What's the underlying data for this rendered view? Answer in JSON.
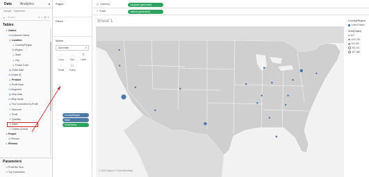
{
  "left_pane": {
    "tabs": [
      "Data",
      "Analytics"
    ],
    "source": "Sample - Superstore",
    "search_placeholder": "Search",
    "tools": "≡ ▿ ▥ ▾",
    "tables_heading": "Tables",
    "fields": [
      {
        "label": "Orders",
        "kind": "head",
        "level": 1,
        "icon": "▾"
      },
      {
        "label": "Customer Name",
        "kind": "dim",
        "level": 2,
        "icon": "Abc"
      },
      {
        "label": "Location",
        "kind": "head",
        "level": 2,
        "icon": "▾"
      },
      {
        "label": "Country/Region",
        "kind": "dim",
        "level": 3,
        "icon": "⊕"
      },
      {
        "label": "Region",
        "kind": "dim",
        "level": 3,
        "icon": "Abc"
      },
      {
        "label": "State",
        "kind": "dim",
        "level": 3,
        "icon": "⊕"
      },
      {
        "label": "City",
        "kind": "dim",
        "level": 3,
        "icon": "⊕"
      },
      {
        "label": "Postal Code",
        "kind": "dim",
        "level": 3,
        "icon": "⊕"
      },
      {
        "label": "Order Date",
        "kind": "dim",
        "level": 2,
        "icon": "▦"
      },
      {
        "label": "Order ID",
        "kind": "dim",
        "level": 2,
        "icon": "Abc"
      },
      {
        "label": "Product",
        "kind": "head",
        "level": 2,
        "icon": "▸"
      },
      {
        "label": "Profit Ratio",
        "kind": "meas",
        "level": 2,
        "icon": "=#"
      },
      {
        "label": "Segment",
        "kind": "dim",
        "level": 2,
        "icon": "Abc"
      },
      {
        "label": "Ship Date",
        "kind": "dim",
        "level": 2,
        "icon": "▦"
      },
      {
        "label": "Ship Mode",
        "kind": "dim",
        "level": 2,
        "icon": "Abc"
      },
      {
        "label": "Top Customers by Profit",
        "kind": "dim",
        "level": 2,
        "icon": "◉"
      },
      {
        "label": "Discount",
        "kind": "meas",
        "level": 2,
        "icon": "#"
      },
      {
        "label": "Profit",
        "kind": "meas",
        "level": 2,
        "icon": "#"
      },
      {
        "label": "Quantity",
        "kind": "meas",
        "level": 2,
        "icon": "#"
      },
      {
        "label": "Sales",
        "kind": "meas",
        "level": 2,
        "icon": "#",
        "highlight": true
      },
      {
        "label": "Orders (Count)",
        "kind": "meas",
        "level": 2,
        "icon": "#"
      },
      {
        "label": "People",
        "kind": "head",
        "level": 1,
        "icon": "▾"
      },
      {
        "label": "Person",
        "kind": "dim",
        "level": 2,
        "icon": "Abc"
      },
      {
        "label": "Returns",
        "kind": "head",
        "level": 1,
        "icon": "▸"
      }
    ],
    "parameters_heading": "Parameters",
    "parameters": [
      "Profit Bin Size",
      "Top Customers"
    ]
  },
  "cards": {
    "pages": "Pages",
    "filters": "Filters",
    "marks": "Marks",
    "mark_type": "Automatic",
    "mark_buttons": [
      {
        "label": "Color",
        "icon": "∷"
      },
      {
        "label": "Size",
        "icon": "◌"
      },
      {
        "label": "Label",
        "icon": "T"
      },
      {
        "label": "Detail",
        "icon": "∴"
      },
      {
        "label": "Tooltip",
        "icon": "▭"
      }
    ],
    "mark_pills": [
      {
        "label": "Country/Region",
        "kind": "dim",
        "icon": "∴"
      },
      {
        "label": "State",
        "kind": "dim",
        "icon": "∴"
      },
      {
        "label": "SUM(Sales)",
        "kind": "meas",
        "icon": "◌"
      }
    ]
  },
  "shelves": {
    "columns_label": "Columns",
    "columns_pill": "Longitude (generated)",
    "rows_label": "Rows",
    "rows_pill": "Latitude (generated)"
  },
  "view": {
    "title": "Sheet 1",
    "attribution": "© 2024 Mapbox © OpenStreetMap",
    "points": [
      {
        "name": "Washington",
        "lon": -120.6,
        "lat": 47.4,
        "size": 1
      },
      {
        "name": "Oregon",
        "lon": -120.5,
        "lat": 44.0,
        "size": 1
      },
      {
        "name": "California",
        "lon": -119.5,
        "lat": 37.2,
        "size": 3
      },
      {
        "name": "Nevada",
        "lon": -116.6,
        "lat": 39.3,
        "size": 1
      },
      {
        "name": "Arizona",
        "lon": -111.7,
        "lat": 34.3,
        "size": 1
      },
      {
        "name": "Colorado",
        "lon": -105.5,
        "lat": 39.0,
        "size": 1
      },
      {
        "name": "Texas",
        "lon": -99.3,
        "lat": 31.4,
        "size": 2
      },
      {
        "name": "Illinois",
        "lon": -89.2,
        "lat": 40.0,
        "size": 1
      },
      {
        "name": "Michigan",
        "lon": -84.7,
        "lat": 43.5,
        "size": 1
      },
      {
        "name": "Ohio",
        "lon": -82.8,
        "lat": 40.3,
        "size": 1
      },
      {
        "name": "Kentucky",
        "lon": -85.3,
        "lat": 37.5,
        "size": 1
      },
      {
        "name": "Tennessee",
        "lon": -86.4,
        "lat": 35.9,
        "size": 1
      },
      {
        "name": "Georgia",
        "lon": -83.4,
        "lat": 32.7,
        "size": 1
      },
      {
        "name": "Florida",
        "lon": -81.7,
        "lat": 28.6,
        "size": 1
      },
      {
        "name": "North Carolina",
        "lon": -79.4,
        "lat": 35.5,
        "size": 1
      },
      {
        "name": "Virginia",
        "lon": -78.8,
        "lat": 37.5,
        "size": 1
      },
      {
        "name": "Pennsylvania",
        "lon": -77.6,
        "lat": 40.9,
        "size": 1
      },
      {
        "name": "New York",
        "lon": -75.5,
        "lat": 42.9,
        "size": 2
      },
      {
        "name": "Massachusetts",
        "lon": -71.8,
        "lat": 42.3,
        "size": 1
      }
    ]
  },
  "legend": {
    "color_title": "Country/Region",
    "color_item": "United States",
    "size_title": "SUM(Sales)",
    "size_items": [
      "600",
      "≤100,000",
      "200,000",
      "300,000",
      "457,688"
    ]
  },
  "colors": {
    "dim_pill": "#4e79a7",
    "meas_pill": "#2ca25f",
    "mark": "#4e79a7",
    "land": "#cfcfcf",
    "water": "#f2f2f2",
    "annotation": "#c62828"
  }
}
